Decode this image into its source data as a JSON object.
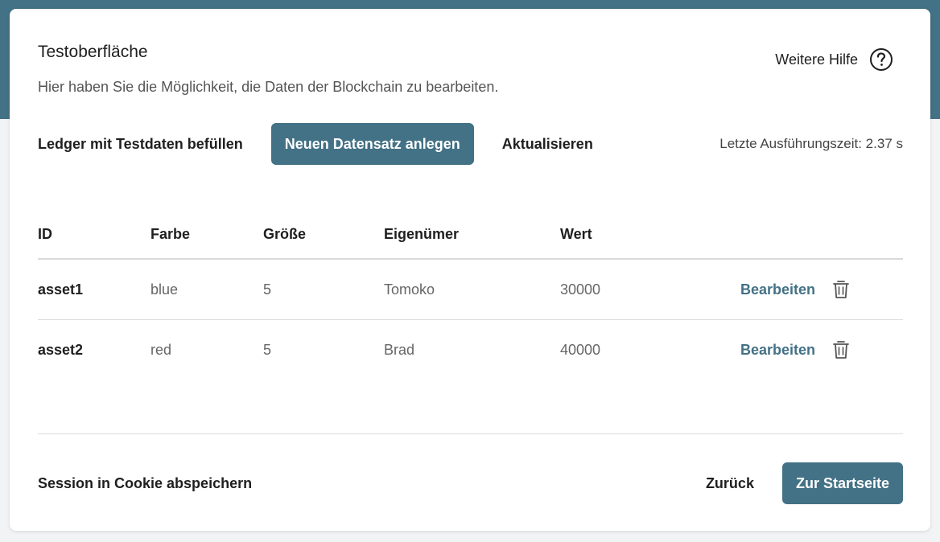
{
  "header": {
    "title": "Testoberfläche",
    "subtitle": "Hier haben Sie die Möglichkeit, die Daten der Blockchain zu bearbeiten.",
    "help_label": "Weitere Hilfe",
    "help_icon": "question-circle-icon"
  },
  "toolbar": {
    "fill_label": "Ledger mit Testdaten befüllen",
    "new_label": "Neuen Datensatz anlegen",
    "refresh_label": "Aktualisieren",
    "exec_time": "Letzte Ausführungszeit: 2.37 s"
  },
  "table": {
    "columns": [
      "ID",
      "Farbe",
      "Größe",
      "Eigenümer",
      "Wert"
    ],
    "rows": [
      {
        "id": "asset1",
        "farbe": "blue",
        "groesse": "5",
        "eigentuemer": "Tomoko",
        "wert": "30000",
        "edit_label": "Bearbeiten",
        "delete_icon": "trash-icon"
      },
      {
        "id": "asset2",
        "farbe": "red",
        "groesse": "5",
        "eigentuemer": "Brad",
        "wert": "40000",
        "edit_label": "Bearbeiten",
        "delete_icon": "trash-icon"
      }
    ]
  },
  "footer": {
    "cookie_label": "Session in Cookie abspeichern",
    "back_label": "Zurück",
    "home_label": "Zur Startseite"
  },
  "colors": {
    "accent": "#437185",
    "background": "#f1f3f5",
    "text": "#1f1f1f",
    "muted_text": "#666666"
  }
}
